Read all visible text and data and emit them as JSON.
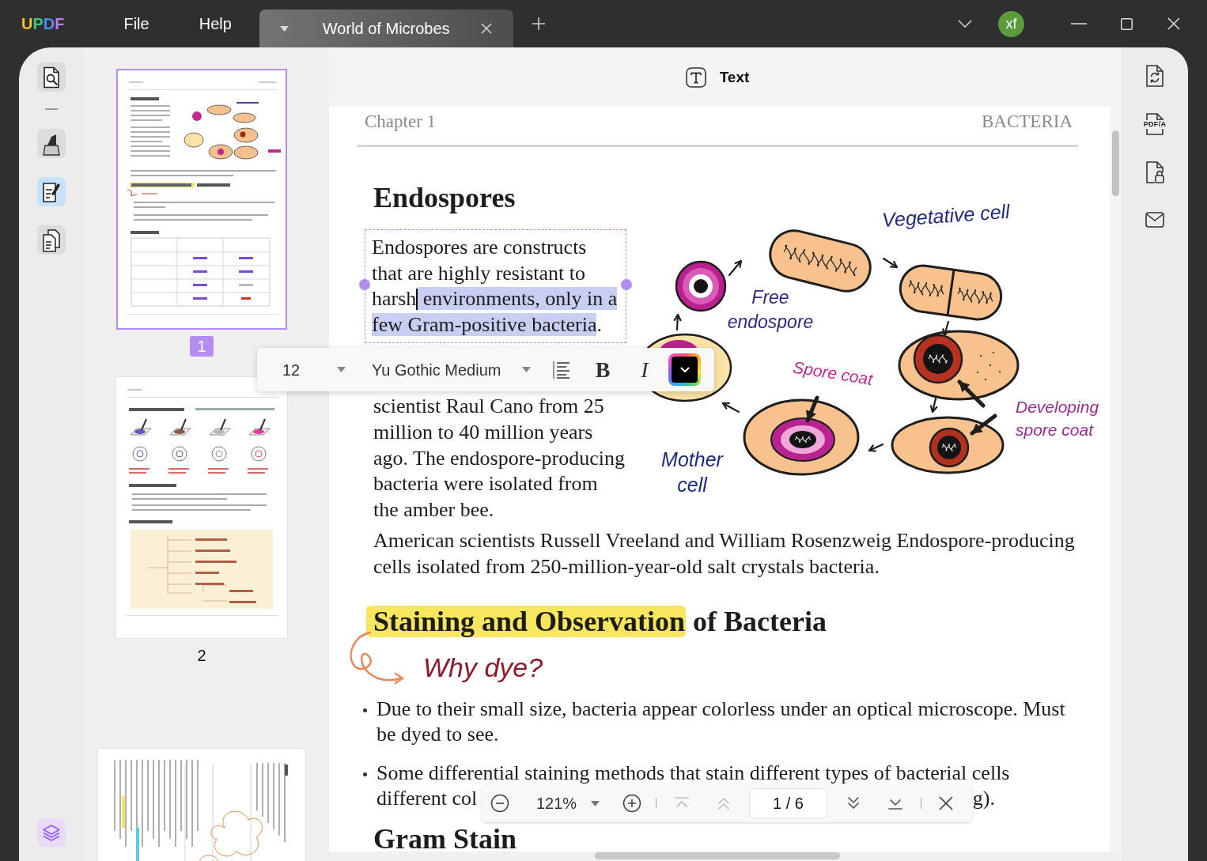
{
  "app": {
    "logo": "UPDF",
    "menu": [
      {
        "label": "File"
      },
      {
        "label": "Help"
      }
    ]
  },
  "tabs": [
    {
      "title": "World of Microbes",
      "selected": true
    }
  ],
  "account": {
    "initials": "xf"
  },
  "tool_rail": {
    "groups": [
      [
        {
          "kind": "reader",
          "selected": false
        }
      ],
      [
        {
          "kind": "comment",
          "selected": false
        },
        {
          "kind": "edit",
          "selected": true
        },
        {
          "kind": "organize",
          "selected": false
        }
      ]
    ]
  },
  "thumbnails": [
    {
      "kind": "portrait",
      "label": "1",
      "selected": true
    },
    {
      "kind": "portrait",
      "label": "2",
      "selected": false
    },
    {
      "kind": "landscape",
      "selected": false
    }
  ],
  "mode_header": {
    "label": "Text"
  },
  "page": {
    "header_left": "Chapter 1",
    "header_right": "BACTERIA",
    "title": "Endospores",
    "edit_box": {
      "text_before_cursor": "Endospores are constructs that are highly resistant to harsh",
      "selected_text": "environments, only in a few Gram-positive bacteria",
      "text_after": "."
    },
    "paragraph_below_toolbar": "scientist Raul Cano from 25 million to 40 million years ago. The endospore-producing bacteria were isolated from the amber bee.",
    "figure": {
      "labels": [
        {
          "text": "Vegetative cell",
          "color": "#1f2a80"
        },
        {
          "text": "Free endospore",
          "color": "#2d2a85"
        },
        {
          "text": "Spore coat",
          "color": "#c0288c"
        },
        {
          "text": "Developing spore coat",
          "color": "#9a2a8f"
        },
        {
          "text": "Mother cell",
          "color": "#1f2a80"
        }
      ]
    },
    "paragraph": "American scientists Russell Vreeland and William Rosenzweig Endospore-producing cells isolated from 250-million-year-old salt crystals bacteria.",
    "section_heading": {
      "parts": [
        {
          "text": "Staining and Observation",
          "highlighted": true
        },
        {
          "text": "of Bacteria",
          "highlighted": false
        }
      ]
    },
    "handwritten_note": "Why dye?",
    "bullets": [
      {
        "kind": "plain",
        "text": "Due to their small size, bacteria appear colorless under an optical microscope. Must be dyed to see."
      },
      {
        "kind": "covered",
        "line_1": "Some differential staining methods that stain different types of bacterial cells",
        "line_2_start": "different col",
        "line_2_end": "g)."
      }
    ],
    "next_heading": "Gram Stain"
  },
  "text_toolbar": {
    "font_size": "12",
    "font": "Yu Gothic Medium",
    "bold": "B",
    "italic": "I",
    "color": "#000000"
  },
  "zoom_bar": {
    "zoom": "121%",
    "nav": [
      {
        "kind": "first",
        "disabled": true
      },
      {
        "kind": "previous",
        "disabled": true
      },
      {
        "kind": "next",
        "disabled": false
      },
      {
        "kind": "last",
        "disabled": false
      }
    ],
    "page_indicator": "1 / 6"
  },
  "right_rail": {
    "items": [
      {
        "kind": "convert"
      },
      {
        "kind": "pdfa",
        "label": "PDF/A"
      },
      {
        "kind": "protect"
      },
      {
        "kind": "share"
      }
    ]
  }
}
